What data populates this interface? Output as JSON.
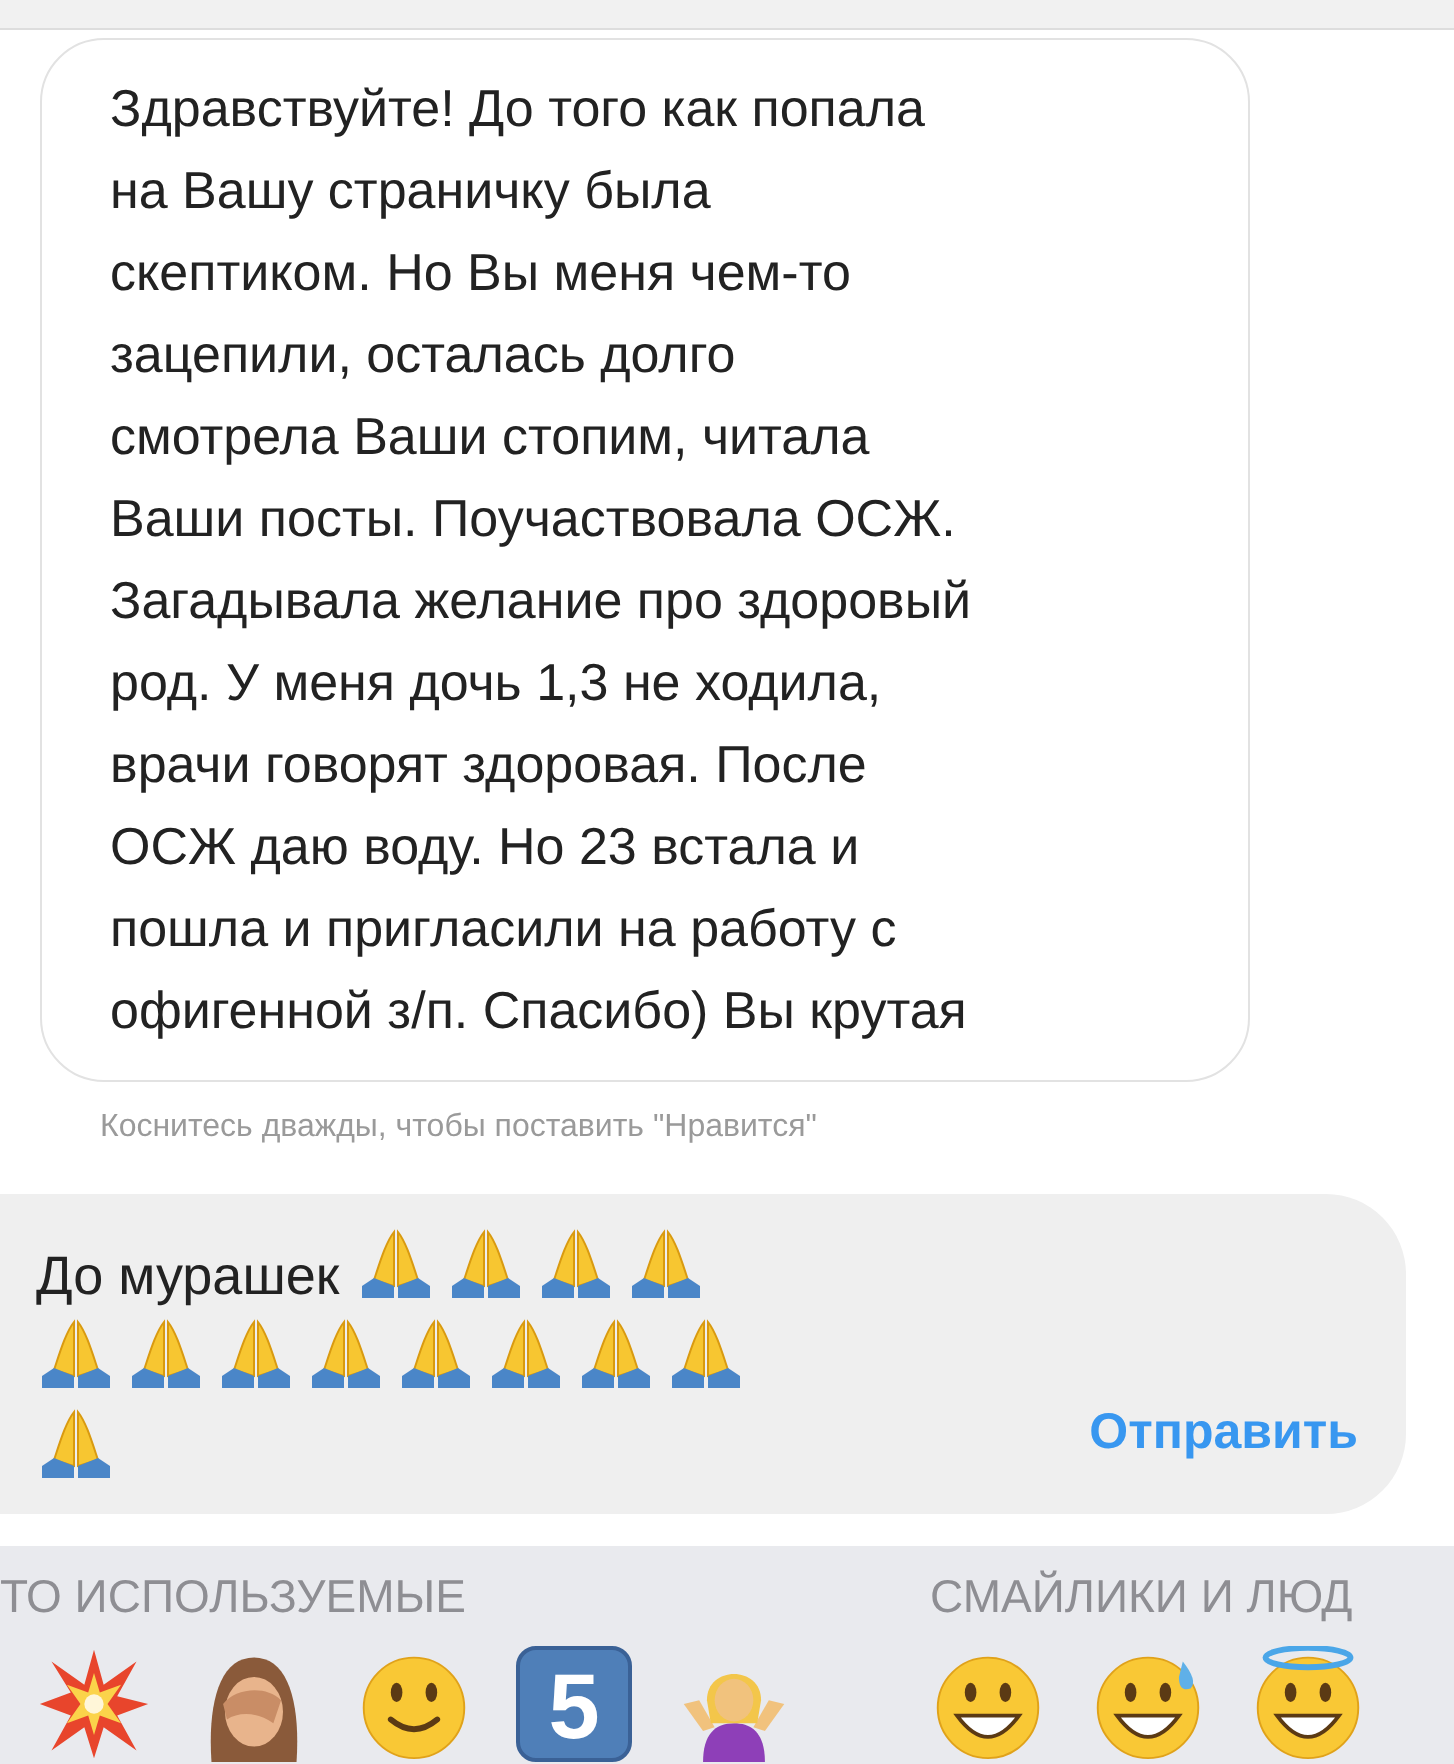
{
  "message": {
    "lines": [
      "Здравствуйте! До того как попала",
      "на Вашу страничку была",
      "скептиком. Но Вы меня чем-то",
      "зацепили, осталась долго",
      "смотрела Ваши стопим, читала",
      "Ваши посты. Поучаствовала ОСЖ.",
      "Загадывала желание про здоровый",
      "род. У меня дочь 1,3 не ходила,",
      "врачи говорят здоровая. После",
      "ОСЖ даю воду. Но 23 встала и",
      "пошла и пригласили на работу с",
      "офигенной з/п. Спасибо) Вы крутая"
    ]
  },
  "like_hint": "Коснитесь дважды, чтобы поставить \"Нравится\"",
  "composer": {
    "value": "До мурашек",
    "emojis": [
      {
        "kind": "pray"
      },
      {
        "kind": "pray"
      },
      {
        "kind": "pray"
      },
      {
        "kind": "pray"
      },
      {
        "kind": "pray"
      },
      {
        "kind": "pray"
      },
      {
        "kind": "pray"
      },
      {
        "kind": "pray"
      },
      {
        "kind": "pray"
      },
      {
        "kind": "pray"
      },
      {
        "kind": "pray"
      },
      {
        "kind": "pray"
      },
      {
        "kind": "pray"
      }
    ],
    "send": "Отправить"
  },
  "emoji_keyboard": {
    "categories": [
      {
        "label": "ТО ИСПОЛЬЗУЕМЫЕ",
        "emojis": [
          {
            "kind": "collision"
          },
          {
            "kind": "facepalm"
          },
          {
            "kind": "smile"
          },
          {
            "kind": "keycap",
            "label": "5"
          },
          {
            "kind": "shrug"
          }
        ]
      },
      {
        "label": "СМАЙЛИКИ И ЛЮД",
        "emojis": [
          {
            "kind": "grin"
          },
          {
            "kind": "sweat"
          },
          {
            "kind": "halo"
          }
        ]
      }
    ]
  }
}
